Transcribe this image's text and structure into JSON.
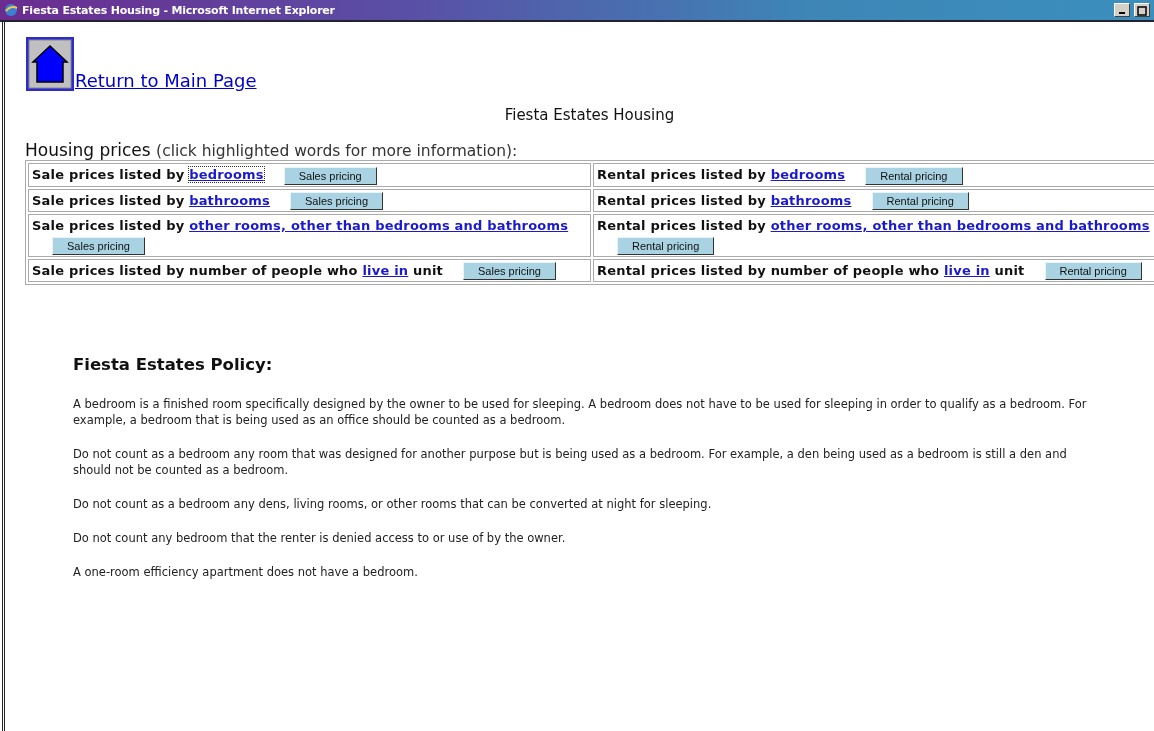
{
  "window": {
    "title": "Fiesta Estates Housing - Microsoft Internet Explorer"
  },
  "return_link": "Return to Main Page",
  "page_title": "Fiesta Estates Housing",
  "prices_heading": {
    "title": "Housing prices",
    "note": "(click highlighted words for more information):"
  },
  "table": {
    "rows": [
      [
        {
          "before": "Sale prices listed by ",
          "link": "bedrooms",
          "focused": true,
          "button": "Sales pricing"
        },
        {
          "before": "Rental prices listed by ",
          "link": "bedrooms",
          "focused": false,
          "button": "Rental pricing"
        }
      ],
      [
        {
          "before": "Sale prices listed by ",
          "link": "bathrooms",
          "focused": false,
          "button": "Sales pricing"
        },
        {
          "before": "Rental prices listed by ",
          "link": "bathrooms",
          "focused": false,
          "button": "Rental pricing"
        }
      ],
      [
        {
          "before": "Sale prices listed by ",
          "link": "other rooms, other than bedrooms and bathrooms",
          "focused": false,
          "button": "Sales pricing"
        },
        {
          "before": "Rental prices listed by ",
          "link": "other rooms, other than bedrooms and bathrooms",
          "focused": false,
          "button": "Rental pricing"
        }
      ],
      [
        {
          "before": "Sale prices listed by number of people who ",
          "link": "live in",
          "after": " unit",
          "focused": false,
          "button": "Sales pricing"
        },
        {
          "before": "Rental prices listed by number of people who ",
          "link": "live in",
          "after": " unit",
          "focused": false,
          "button": "Rental pricing"
        }
      ]
    ]
  },
  "policy": {
    "title": "Fiesta Estates Policy:",
    "paragraphs": [
      "A bedroom is a finished room specifically designed by the owner to be used for sleeping. A bedroom does not have to be used for sleeping in order to qualify as a bedroom. For example, a bedroom that is being used as an office should be counted as a bedroom.",
      "Do not count as a bedroom any room that was designed for another purpose but is being used as a bedroom. For example, a den being used as a bedroom is still a den and should not be counted as a bedroom.",
      "Do not count as a bedroom any dens, living rooms, or other rooms that can be converted at night for sleeping.",
      "Do not count any bedroom that the renter is denied access to or use of by the owner.",
      "A one-room efficiency apartment does not have a bedroom."
    ]
  }
}
